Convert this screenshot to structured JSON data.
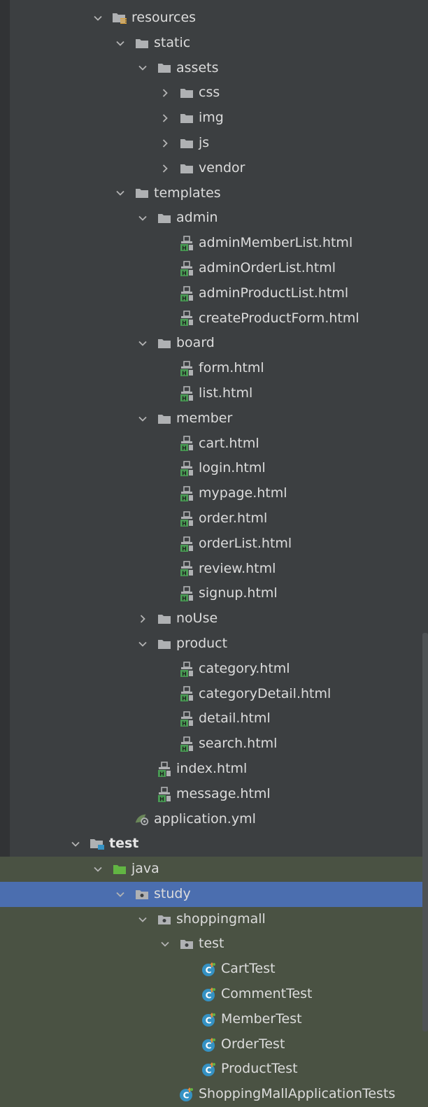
{
  "tree": [
    {
      "label": "resources",
      "depth": 3,
      "chevron": "down",
      "icon": "resources-folder-icon"
    },
    {
      "label": "static",
      "depth": 4,
      "chevron": "down",
      "icon": "folder-icon"
    },
    {
      "label": "assets",
      "depth": 5,
      "chevron": "down",
      "icon": "folder-icon"
    },
    {
      "label": "css",
      "depth": 6,
      "chevron": "right",
      "icon": "folder-icon"
    },
    {
      "label": "img",
      "depth": 6,
      "chevron": "right",
      "icon": "folder-icon"
    },
    {
      "label": "js",
      "depth": 6,
      "chevron": "right",
      "icon": "folder-icon"
    },
    {
      "label": "vendor",
      "depth": 6,
      "chevron": "right",
      "icon": "folder-icon"
    },
    {
      "label": "templates",
      "depth": 4,
      "chevron": "down",
      "icon": "folder-icon"
    },
    {
      "label": "admin",
      "depth": 5,
      "chevron": "down",
      "icon": "folder-icon"
    },
    {
      "label": "adminMemberList.html",
      "depth": 6,
      "chevron": "none",
      "icon": "html-file-icon"
    },
    {
      "label": "adminOrderList.html",
      "depth": 6,
      "chevron": "none",
      "icon": "html-file-icon"
    },
    {
      "label": "adminProductList.html",
      "depth": 6,
      "chevron": "none",
      "icon": "html-file-icon"
    },
    {
      "label": "createProductForm.html",
      "depth": 6,
      "chevron": "none",
      "icon": "html-file-icon"
    },
    {
      "label": "board",
      "depth": 5,
      "chevron": "down",
      "icon": "folder-icon"
    },
    {
      "label": "form.html",
      "depth": 6,
      "chevron": "none",
      "icon": "html-file-icon"
    },
    {
      "label": "list.html",
      "depth": 6,
      "chevron": "none",
      "icon": "html-file-icon"
    },
    {
      "label": "member",
      "depth": 5,
      "chevron": "down",
      "icon": "folder-icon"
    },
    {
      "label": "cart.html",
      "depth": 6,
      "chevron": "none",
      "icon": "html-file-icon"
    },
    {
      "label": "login.html",
      "depth": 6,
      "chevron": "none",
      "icon": "html-file-icon"
    },
    {
      "label": "mypage.html",
      "depth": 6,
      "chevron": "none",
      "icon": "html-file-icon"
    },
    {
      "label": "order.html",
      "depth": 6,
      "chevron": "none",
      "icon": "html-file-icon"
    },
    {
      "label": "orderList.html",
      "depth": 6,
      "chevron": "none",
      "icon": "html-file-icon"
    },
    {
      "label": "review.html",
      "depth": 6,
      "chevron": "none",
      "icon": "html-file-icon"
    },
    {
      "label": "signup.html",
      "depth": 6,
      "chevron": "none",
      "icon": "html-file-icon"
    },
    {
      "label": "noUse",
      "depth": 5,
      "chevron": "right",
      "icon": "folder-icon"
    },
    {
      "label": "product",
      "depth": 5,
      "chevron": "down",
      "icon": "folder-icon"
    },
    {
      "label": "category.html",
      "depth": 6,
      "chevron": "none",
      "icon": "html-file-icon"
    },
    {
      "label": "categoryDetail.html",
      "depth": 6,
      "chevron": "none",
      "icon": "html-file-icon"
    },
    {
      "label": "detail.html",
      "depth": 6,
      "chevron": "none",
      "icon": "html-file-icon"
    },
    {
      "label": "search.html",
      "depth": 6,
      "chevron": "none",
      "icon": "html-file-icon"
    },
    {
      "label": "index.html",
      "depth": 5,
      "chevron": "none",
      "icon": "html-file-icon"
    },
    {
      "label": "message.html",
      "depth": 5,
      "chevron": "none",
      "icon": "html-file-icon"
    },
    {
      "label": "application.yml",
      "depth": 4,
      "chevron": "none",
      "icon": "yml-config-icon"
    },
    {
      "label": "test",
      "depth": 2,
      "chevron": "down",
      "icon": "test-root-folder-icon",
      "bold": true
    },
    {
      "label": "java",
      "depth": 3,
      "chevron": "down",
      "icon": "test-sources-folder-icon",
      "state": "green"
    },
    {
      "label": "study",
      "depth": 4,
      "chevron": "down",
      "icon": "package-icon",
      "state": "selected"
    },
    {
      "label": "shoppingmall",
      "depth": 5,
      "chevron": "down",
      "icon": "package-icon",
      "state": "green"
    },
    {
      "label": "test",
      "depth": 6,
      "chevron": "down",
      "icon": "package-icon",
      "state": "green"
    },
    {
      "label": "CartTest",
      "depth": 7,
      "chevron": "none",
      "icon": "test-class-icon",
      "state": "green"
    },
    {
      "label": "CommentTest",
      "depth": 7,
      "chevron": "none",
      "icon": "test-class-icon",
      "state": "green"
    },
    {
      "label": "MemberTest",
      "depth": 7,
      "chevron": "none",
      "icon": "test-class-icon",
      "state": "green"
    },
    {
      "label": "OrderTest",
      "depth": 7,
      "chevron": "none",
      "icon": "test-class-icon",
      "state": "green"
    },
    {
      "label": "ProductTest",
      "depth": 7,
      "chevron": "none",
      "icon": "test-class-icon",
      "state": "green"
    },
    {
      "label": "ShoppingMallApplicationTests",
      "depth": 6,
      "chevron": "none",
      "icon": "test-class-icon",
      "state": "green"
    }
  ],
  "colors": {
    "background": "#3c3f41",
    "selected": "#4b6eaf",
    "test_area": "#4a5243",
    "text": "#dcdcdc",
    "folder": "#afb1b3",
    "test_folder": "#62b543",
    "html_icon": "#499c54",
    "test_class": "#3592c4"
  }
}
